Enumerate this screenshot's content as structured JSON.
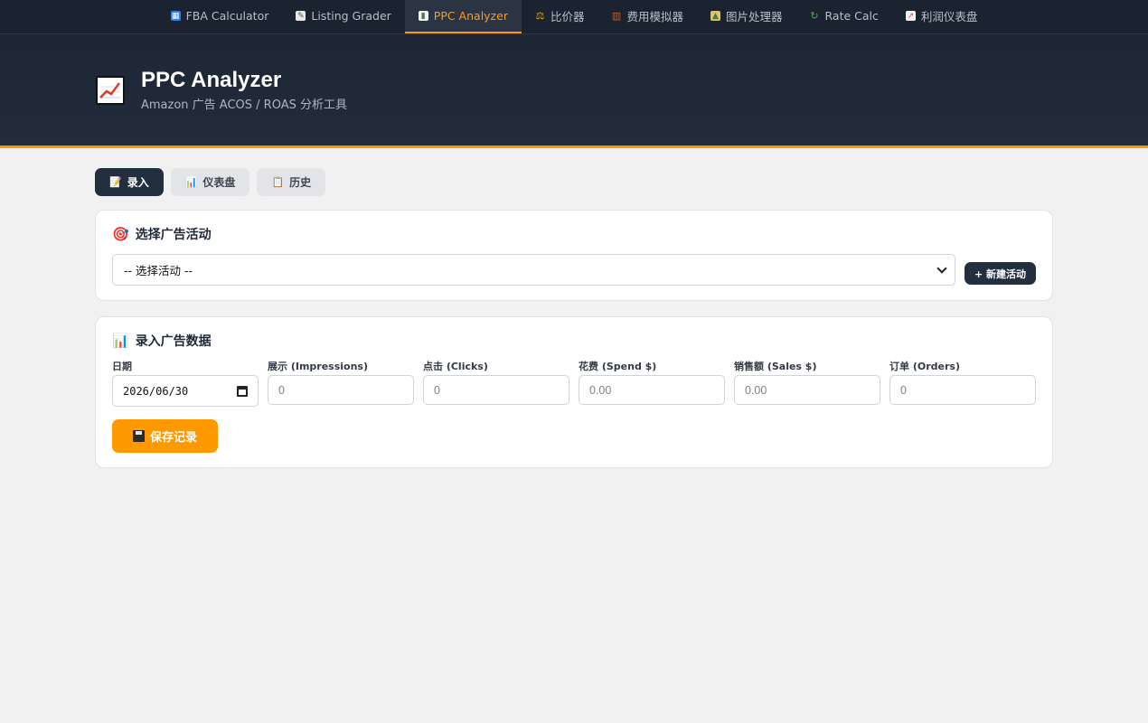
{
  "nav": {
    "items": [
      {
        "label": "FBA Calculator",
        "icon": "grid-icon",
        "color": "#2f7cf6"
      },
      {
        "label": "Listing Grader",
        "icon": "memo-icon",
        "color": "#d9d9d9"
      },
      {
        "label": "PPC Analyzer",
        "icon": "bar-chart-icon",
        "color": "#ff9900"
      },
      {
        "label": "比价器",
        "icon": "scales-icon",
        "color": "#e0a526"
      },
      {
        "label": "费用模拟器",
        "icon": "abacus-icon",
        "color": "#c0612b"
      },
      {
        "label": "图片处理器",
        "icon": "picture-icon",
        "color": "#6a9a4a"
      },
      {
        "label": "Rate Calc",
        "icon": "arrows-cycle-icon",
        "color": "#4caf50"
      },
      {
        "label": "利润仪表盘",
        "icon": "trend-chart-icon",
        "color": "#e04b4b"
      }
    ],
    "active_index": 2
  },
  "hero": {
    "title": "PPC Analyzer",
    "subtitle": "Amazon 广告 ACOS / ROAS 分析工具"
  },
  "tabs": [
    {
      "label": "录入",
      "icon": "memo-icon",
      "glyph": "📝"
    },
    {
      "label": "仪表盘",
      "icon": "bar-chart-icon",
      "glyph": "📊"
    },
    {
      "label": "历史",
      "icon": "clipboard-icon",
      "glyph": "📋"
    }
  ],
  "campaign": {
    "title": "选择广告活动",
    "select_value": "-- 选择活动 --",
    "new_button": "+ 新建活动"
  },
  "entry": {
    "title": "录入广告数据",
    "fields": {
      "date": {
        "label": "日期",
        "value": "2026/06/30"
      },
      "impressions": {
        "label": "展示 (Impressions)",
        "placeholder": "0"
      },
      "clicks": {
        "label": "点击 (Clicks)",
        "placeholder": "0"
      },
      "spend": {
        "label": "花费 (Spend $)",
        "placeholder": "0.00"
      },
      "sales": {
        "label": "销售额 (Sales $)",
        "placeholder": "0.00"
      },
      "orders": {
        "label": "订单 (Orders)",
        "placeholder": "0"
      }
    },
    "save_button": "保存记录"
  },
  "colors": {
    "accent": "#ff9900",
    "dark": "#232f3e"
  }
}
